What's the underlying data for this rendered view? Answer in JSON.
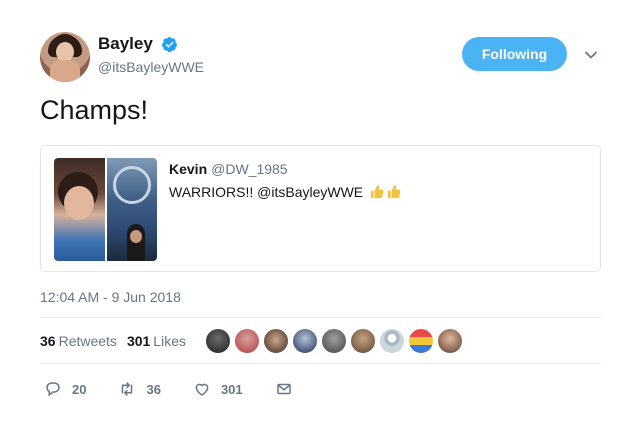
{
  "author": {
    "display_name": "Bayley",
    "handle": "@itsBayleyWWE",
    "verified": true
  },
  "follow_button": {
    "label": "Following"
  },
  "tweet": {
    "text": "Champs!"
  },
  "quoted_tweet": {
    "author_name": "Kevin",
    "author_handle": "@DW_1985",
    "text": "WARRIORS!! @itsBayleyWWE "
  },
  "timestamp": "12:04 AM - 9 Jun 2018",
  "stats": {
    "retweets_count": "36",
    "retweets_label": "Retweets",
    "likes_count": "301",
    "likes_label": "Likes"
  },
  "actions": {
    "reply_count": "20",
    "retweet_count": "36",
    "like_count": "301"
  },
  "colors": {
    "accent": "#4ab3f4",
    "secondary_text": "#657786",
    "border": "#e1e8ed"
  },
  "icons": [
    "verified-badge",
    "chevron-down",
    "thumbs-up",
    "reply",
    "retweet",
    "heart",
    "envelope"
  ]
}
